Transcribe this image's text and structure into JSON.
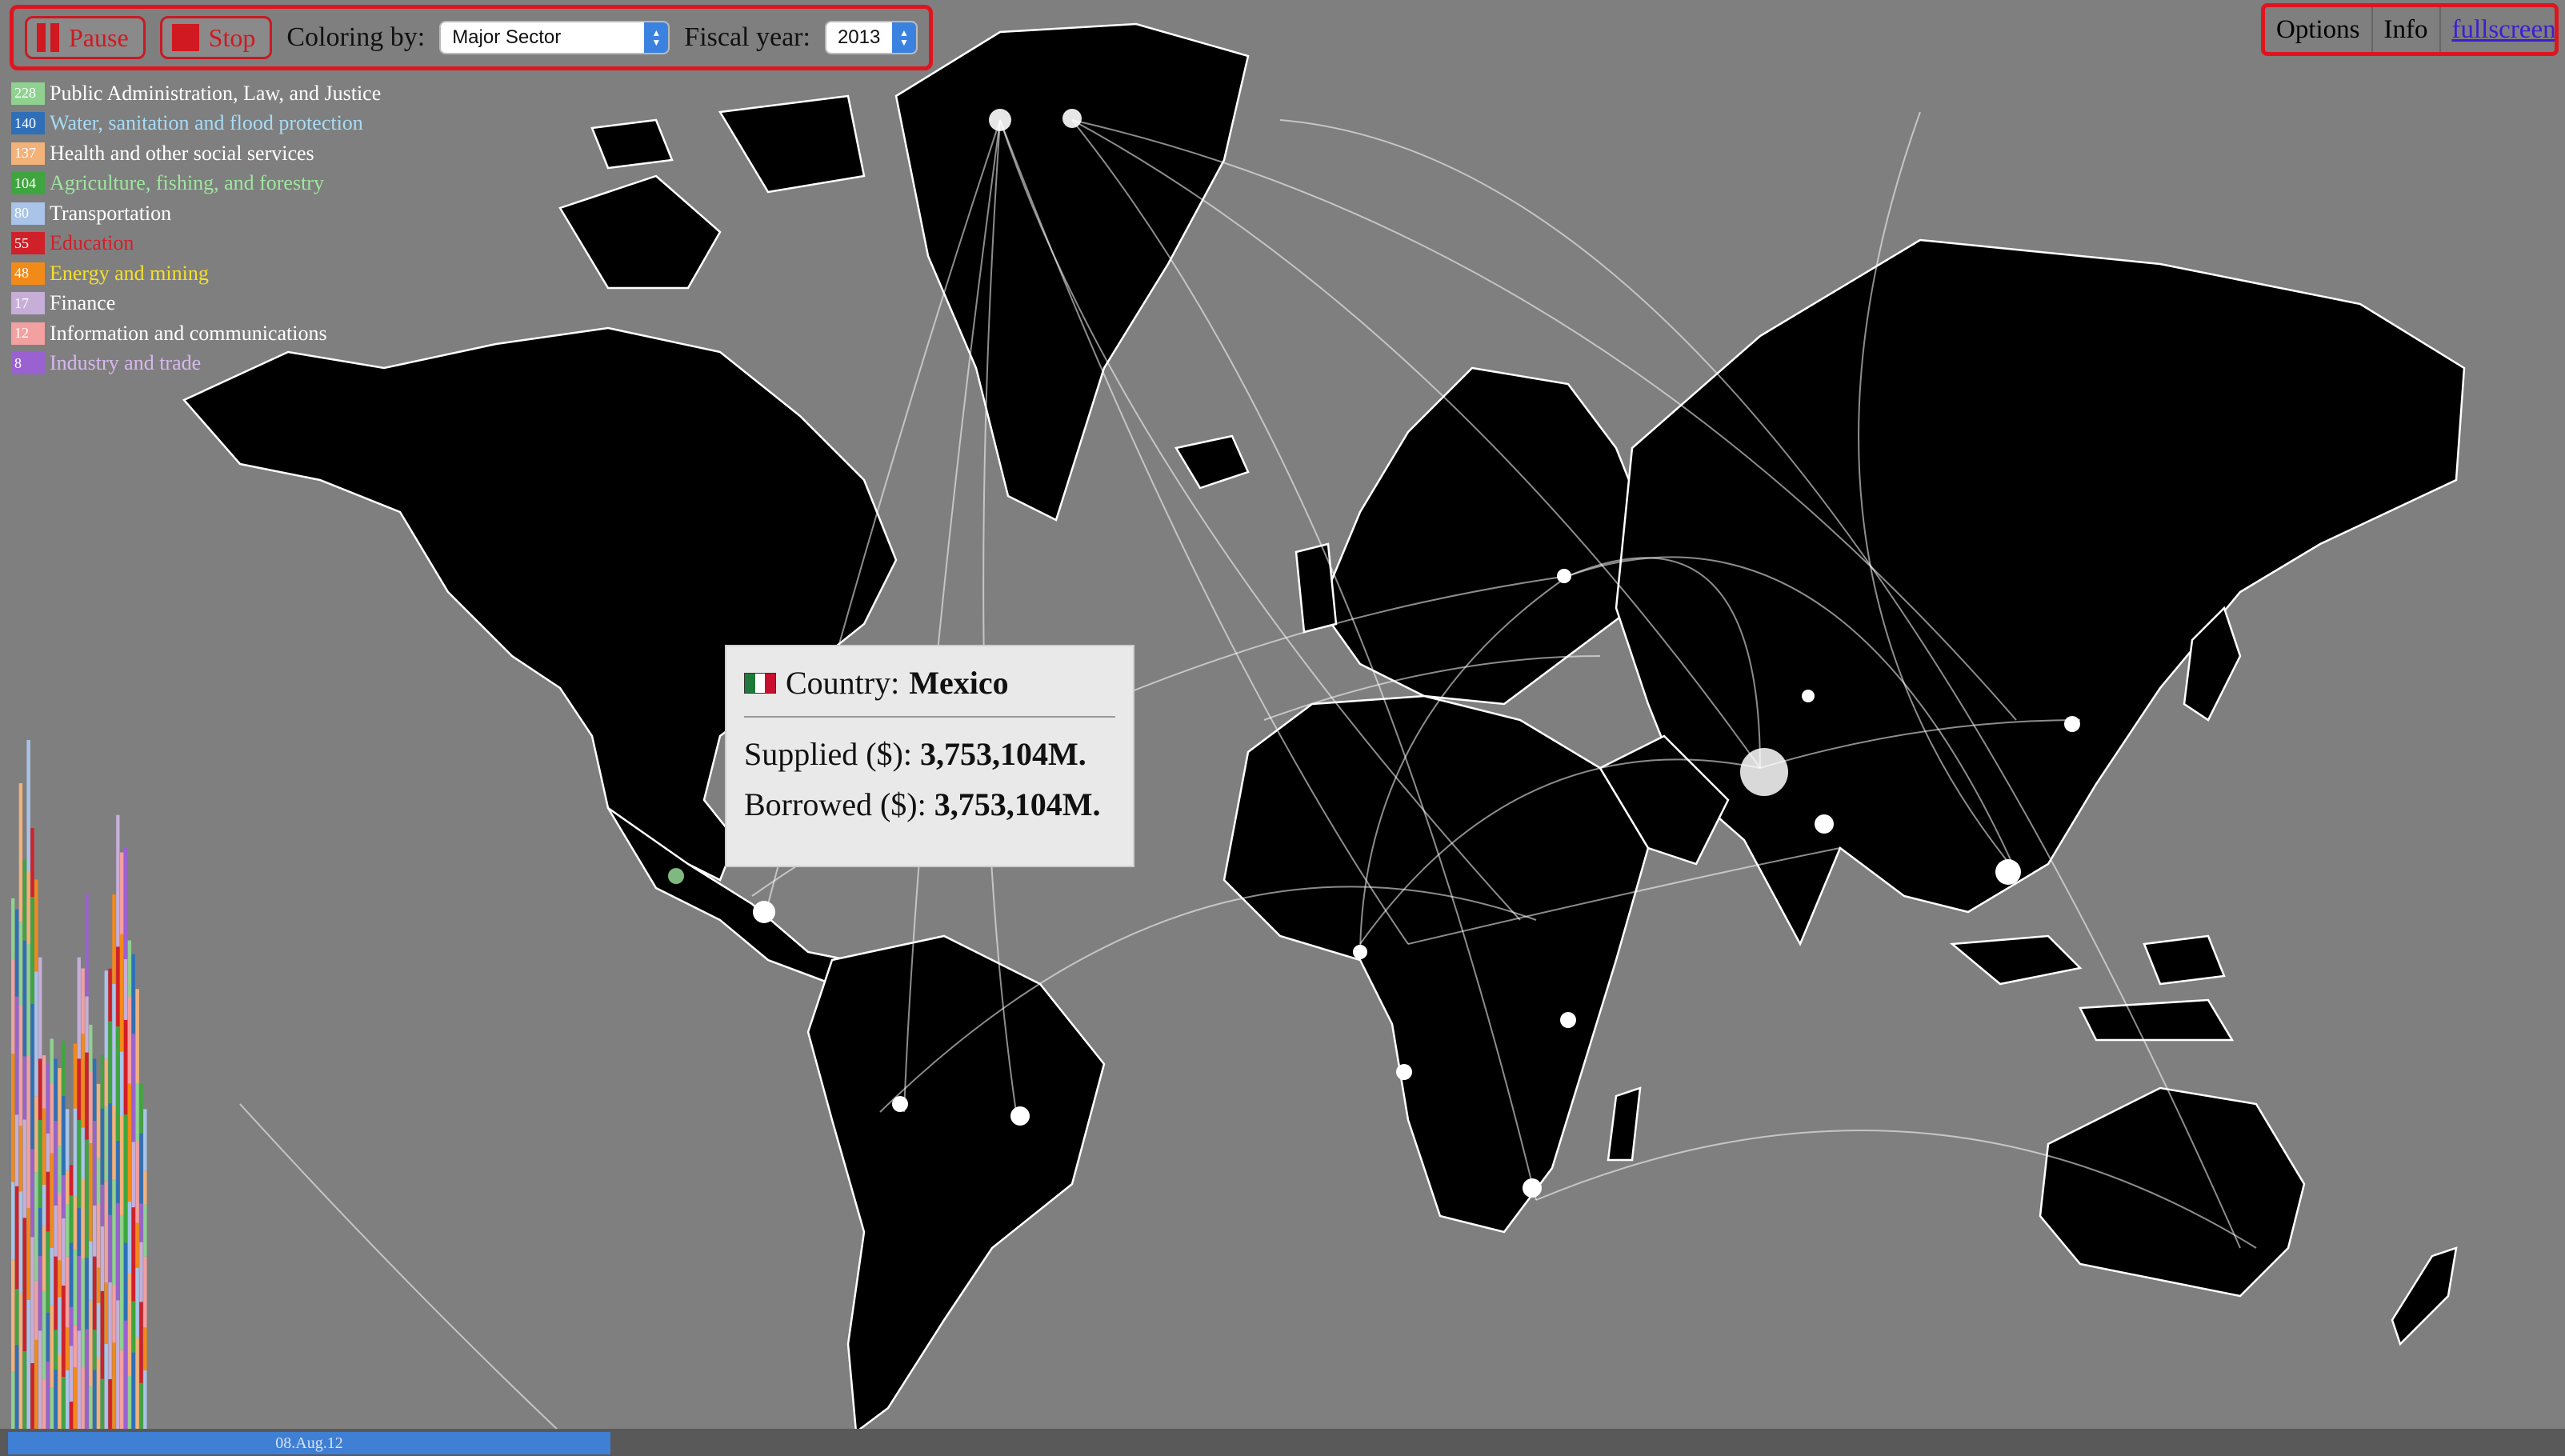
{
  "controls": {
    "pause_label": "Pause",
    "stop_label": "Stop",
    "coloring_label": "Coloring by:",
    "coloring_value": "Major Sector",
    "fiscal_label": "Fiscal year:",
    "fiscal_value": "2013"
  },
  "menu": {
    "options_label": "Options",
    "info_label": "Info",
    "fullscreen_label": "fullscreen"
  },
  "legend": [
    {
      "count": "228",
      "label": "Public Administration, Law, and Justice",
      "color": "#8fd18f",
      "text_color": "#ffffff"
    },
    {
      "count": "140",
      "label": "Water, sanitation and flood protection",
      "color": "#2f6fb8",
      "text_color": "#a6dcf7"
    },
    {
      "count": "137",
      "label": "Health and other social services",
      "color": "#f2b27a",
      "text_color": "#ffffff"
    },
    {
      "count": "104",
      "label": "Agriculture, fishing, and forestry",
      "color": "#3fa53f",
      "text_color": "#9fe79f"
    },
    {
      "count": "80",
      "label": "Transportation",
      "color": "#a9c4e8",
      "text_color": "#ffffff"
    },
    {
      "count": "55",
      "label": "Education",
      "color": "#d0202a",
      "text_color": "#d0202a"
    },
    {
      "count": "48",
      "label": "Energy and mining",
      "color": "#f28a1a",
      "text_color": "#f5e02a"
    },
    {
      "count": "17",
      "label": "Finance",
      "color": "#c7aed9",
      "text_color": "#ffffff"
    },
    {
      "count": "12",
      "label": "Information and communications",
      "color": "#f2a0a0",
      "text_color": "#ffffff"
    },
    {
      "count": "8",
      "label": "Industry and trade",
      "color": "#9a62d0",
      "text_color": "#d8b8f0"
    }
  ],
  "tooltip": {
    "country_label": "Country:",
    "country_value": "Mexico",
    "supplied_label": "Supplied ($):",
    "supplied_value": "3,753,104M.",
    "borrowed_label": "Borrowed ($):",
    "borrowed_value": "3,753,104M.",
    "flag": "mexico-flag-icon"
  },
  "timeline": {
    "date_label": "08.Aug.12",
    "progress": 0.11
  },
  "colors": {
    "background": "#7f7f7f",
    "land": "#000000",
    "flow": "#ffffff",
    "highlight": "#e0141e",
    "timeline_fill": "#3f7fd4"
  }
}
